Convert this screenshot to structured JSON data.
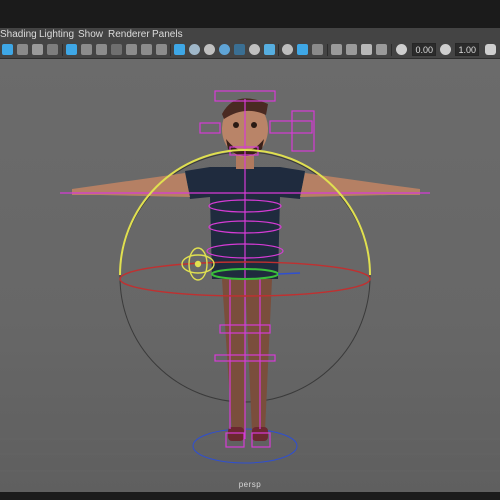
{
  "menubar": {
    "items": [
      {
        "label": "Shading"
      },
      {
        "label": "Lighting"
      },
      {
        "label": "Show"
      },
      {
        "label": "Renderer"
      },
      {
        "label": "Panels"
      }
    ]
  },
  "toolbar": {
    "exposure_value": "0.00",
    "gamma_value": "1.00",
    "icons": [
      "select-camera-icon",
      "camera-attributes-icon",
      "bookmarks-icon",
      "image-plane-icon",
      "grid-icon",
      "film-gate-icon",
      "resolution-gate-icon",
      "gate-mask-icon",
      "field-chart-icon",
      "safe-action-icon",
      "safe-title-icon",
      "wireframe-icon",
      "smooth-shade-icon",
      "default-material-icon",
      "wireframe-on-shaded-icon",
      "textured-icon",
      "use-all-lights-icon",
      "shadows-icon",
      "ambient-occlusion-icon",
      "motion-blur-icon",
      "anti-aliasing-icon",
      "depth-of-field-icon",
      "isolate-select-icon",
      "xray-icon",
      "xray-joints-icon",
      "exposure-icon",
      "gamma-icon",
      "color-management-icon"
    ]
  },
  "viewport": {
    "camera_label": "persp"
  },
  "colors": {
    "menubar_bg": "#444444",
    "viewport_bg": "#6b6b6b",
    "rig_control_magenta": "#d63bd6",
    "selected_arc_yellow": "#e0e050",
    "rotate_x_red": "#c03030",
    "rotate_y_green": "#3ac03a",
    "rotate_z_blue": "#3050d0",
    "icon_accent_blue": "#3ea7e6"
  }
}
